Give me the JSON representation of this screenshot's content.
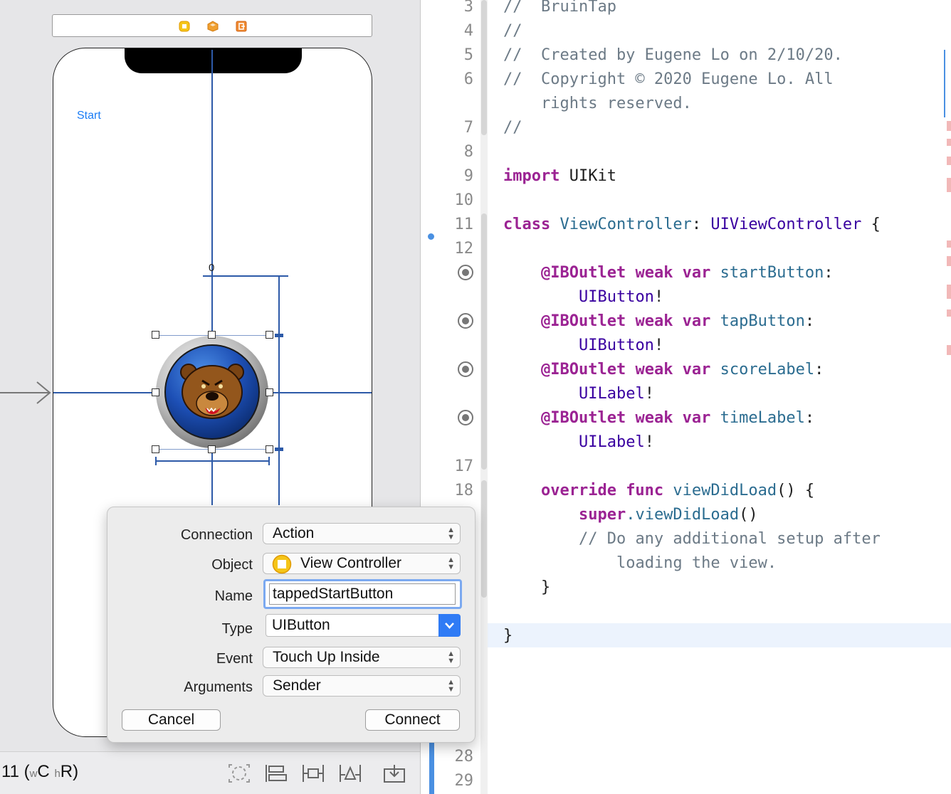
{
  "canvas": {
    "start_button_label": "Start",
    "constraint_value": "0",
    "bottom_bar": {
      "device_label_prefix": "11 (",
      "w_char": "w",
      "w_class": "C",
      "h_char": "h",
      "h_class": "R",
      "device_label_suffix": ")"
    }
  },
  "editor": {
    "lines": [
      {
        "num": "3",
        "text": "//  BruinTap"
      },
      {
        "num": "4",
        "text": "//"
      },
      {
        "num": "5",
        "text": "//  Created by Eugene Lo on 2/10/20."
      },
      {
        "num": "6",
        "text": "//  Copyright © 2020 Eugene Lo. All"
      },
      {
        "num": "",
        "text": "    rights reserved."
      },
      {
        "num": "7",
        "text": "//"
      },
      {
        "num": "8",
        "text": ""
      },
      {
        "num": "9",
        "kw": "import",
        "rest": " UIKit"
      },
      {
        "num": "10",
        "text": ""
      },
      {
        "num": "11",
        "kw": "class",
        "name": "ViewController",
        "sep": ": ",
        "type": "UIViewController",
        "end": " {"
      },
      {
        "num": "12",
        "text": ""
      },
      {
        "num": "17",
        "text": ""
      },
      {
        "num": "18",
        "text": ""
      }
    ],
    "outlets": [
      {
        "attr": "@IBOutlet",
        "kw": "weak var",
        "name": "startButton",
        "type": "UIButton"
      },
      {
        "attr": "@IBOutlet",
        "kw": "weak var",
        "name": "tapButton",
        "type": "UIButton"
      },
      {
        "attr": "@IBOutlet",
        "kw": "weak var",
        "name": "scoreLabel",
        "type": "UILabel"
      },
      {
        "attr": "@IBOutlet",
        "kw": "weak var",
        "name": "timeLabel",
        "type": "UILabel"
      }
    ],
    "method": {
      "override_kw": "override func",
      "name": "viewDidLoad",
      "sig_end": "() {",
      "super_kw": "super",
      "super_call": ".viewDidLoad",
      "super_end": "()",
      "comment1": "// Do any additional setup after",
      "comment2": "loading the view.",
      "close": "}"
    },
    "class_close": "}",
    "bottom_line_numbers": [
      "28",
      "29"
    ]
  },
  "popover": {
    "connection": {
      "label": "Connection",
      "value": "Action"
    },
    "object": {
      "label": "Object",
      "value": "View Controller"
    },
    "name": {
      "label": "Name",
      "value": "tappedStartButton"
    },
    "type": {
      "label": "Type",
      "value": "UIButton"
    },
    "event": {
      "label": "Event",
      "value": "Touch Up Inside"
    },
    "arguments": {
      "label": "Arguments",
      "value": "Sender"
    },
    "cancel_label": "Cancel",
    "connect_label": "Connect"
  },
  "colors": {
    "accent": "#2f7bf5",
    "keyword": "#9b2393",
    "type": "#3900a0",
    "identifier": "#2b6c90",
    "comment": "#6c7a86"
  },
  "icons": [
    "view-controller-icon",
    "first-responder-icon",
    "exit-icon",
    "bear-logo-icon",
    "update-frames-icon",
    "embed-in-icon",
    "align-icon",
    "add-constraints-icon",
    "resolve-issues-icon",
    "outlet-connection-icon"
  ]
}
